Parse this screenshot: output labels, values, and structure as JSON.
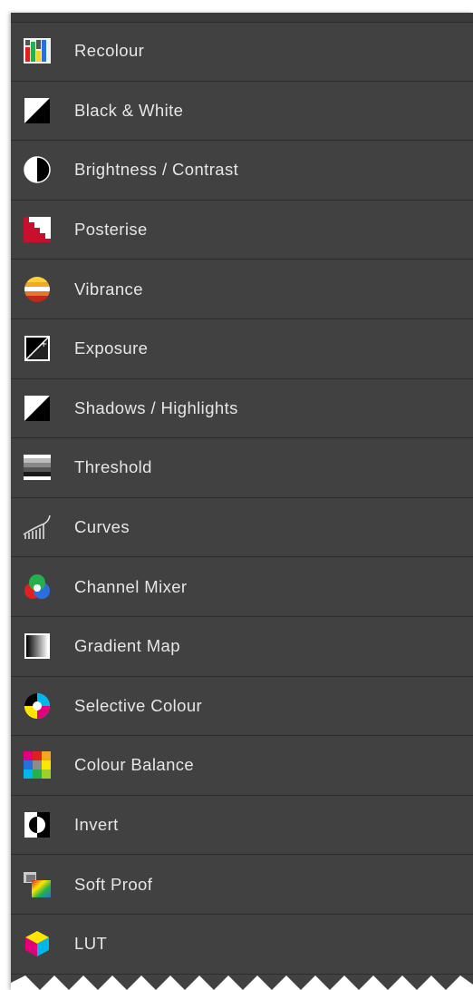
{
  "menu": {
    "items": [
      {
        "label": "Recolour",
        "icon": "recolour-icon"
      },
      {
        "label": "Black & White",
        "icon": "black-white-icon"
      },
      {
        "label": "Brightness / Contrast",
        "icon": "brightness-contrast-icon"
      },
      {
        "label": "Posterise",
        "icon": "posterise-icon"
      },
      {
        "label": "Vibrance",
        "icon": "vibrance-icon"
      },
      {
        "label": "Exposure",
        "icon": "exposure-icon"
      },
      {
        "label": "Shadows / Highlights",
        "icon": "shadows-highlights-icon"
      },
      {
        "label": "Threshold",
        "icon": "threshold-icon"
      },
      {
        "label": "Curves",
        "icon": "curves-icon"
      },
      {
        "label": "Channel Mixer",
        "icon": "channel-mixer-icon"
      },
      {
        "label": "Gradient Map",
        "icon": "gradient-map-icon"
      },
      {
        "label": "Selective Colour",
        "icon": "selective-colour-icon"
      },
      {
        "label": "Colour Balance",
        "icon": "colour-balance-icon"
      },
      {
        "label": "Invert",
        "icon": "invert-icon"
      },
      {
        "label": "Soft Proof",
        "icon": "soft-proof-icon"
      },
      {
        "label": "LUT",
        "icon": "lut-icon"
      }
    ]
  },
  "colors": {
    "panel_bg": "#414141",
    "divider": "#2d2d2d",
    "text": "#e6e6e6"
  }
}
